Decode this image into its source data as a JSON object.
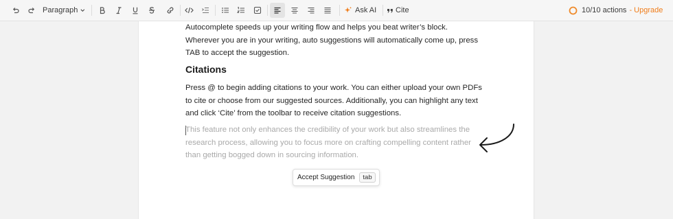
{
  "toolbar": {
    "block_type": "Paragraph",
    "ask_ai_label": "Ask AI",
    "cite_label": "Cite",
    "actions_count": "10/10 actions",
    "upgrade_label": "- Upgrade",
    "icons": [
      "undo-icon",
      "redo-icon",
      "chevron-down-icon",
      "bold-icon",
      "italic-icon",
      "underline-icon",
      "strikethrough-icon",
      "link-icon",
      "code-icon",
      "indent-icon",
      "bullet-list-icon",
      "numbered-list-icon",
      "checklist-icon",
      "align-left-icon",
      "align-center-icon",
      "align-right-icon",
      "align-justify-icon",
      "sparkle-icon",
      "quote-icon",
      "usage-ring-icon"
    ],
    "active_alignment": "left",
    "colors": {
      "accent": "#f07d1a",
      "ring": "#ef8a2a"
    }
  },
  "editor": {
    "paragraph1": {
      "line1": "Autocomplete speeds up your writing flow and helps you beat writer’s block.",
      "line2": "Wherever you are in your writing, auto suggestions will automatically come up, press",
      "line3": "TAB to accept the suggestion."
    },
    "heading": "Citations",
    "paragraph2": {
      "line1": "Press @ to begin adding citations to your work. You can either upload your own PDFs",
      "line2": "to cite or choose from our suggested sources. Additionally, you can highlight any text",
      "line3": "and click ‘Cite’ from the toolbar to receive citation suggestions."
    },
    "suggestion": {
      "line1": "This feature not only enhances the credibility of your work but also streamlines the",
      "line2": "research process, allowing you to focus more on crafting compelling content rather",
      "line3": "than getting bogged down in sourcing information."
    },
    "accept_popup": {
      "label": "Accept Suggestion",
      "key": "tab"
    },
    "block_controls": [
      "add-block-icon",
      "drag-handle-icon"
    ]
  }
}
